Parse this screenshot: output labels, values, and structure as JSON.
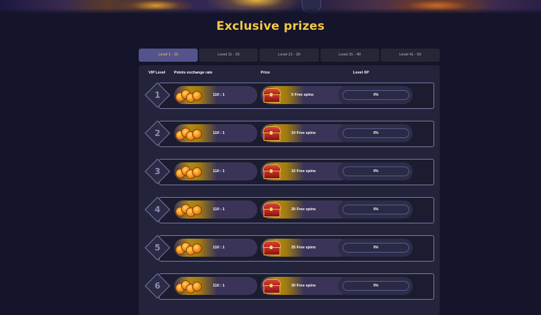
{
  "page": {
    "title": "Exclusive prizes"
  },
  "tabs": [
    {
      "label": "Level 1 - 10",
      "active": true
    },
    {
      "label": "Level 11 - 20",
      "active": false
    },
    {
      "label": "Level 21 - 30",
      "active": false
    },
    {
      "label": "Level 31 - 40",
      "active": false
    },
    {
      "label": "Level 41 - 50",
      "active": false
    }
  ],
  "table": {
    "headers": {
      "vip_level": "VIP Level",
      "points_rate": "Points exchange rate",
      "prize": "Prize",
      "level_xp": "Level XP"
    },
    "rows": [
      {
        "level": "1",
        "rate": "110 : 1",
        "prize": "5 Free spins",
        "xp": "0%"
      },
      {
        "level": "2",
        "rate": "110 : 1",
        "prize": "10 Free spins",
        "xp": "0%"
      },
      {
        "level": "3",
        "rate": "110 : 1",
        "prize": "15 Free spins",
        "xp": "0%"
      },
      {
        "level": "4",
        "rate": "110 : 1",
        "prize": "20 Free spins",
        "xp": "0%"
      },
      {
        "level": "5",
        "rate": "110 : 1",
        "prize": "25 Free spins",
        "xp": "0%"
      },
      {
        "level": "6",
        "rate": "110 : 1",
        "prize": "30 Free spins",
        "xp": "0%"
      }
    ]
  },
  "colors": {
    "accent_gold": "#f4c842",
    "active_tab": "#54538c",
    "background": "#14142b"
  },
  "icons": {
    "rate_icon": "coins-icon",
    "prize_icon": "treasure-chest-icon"
  }
}
